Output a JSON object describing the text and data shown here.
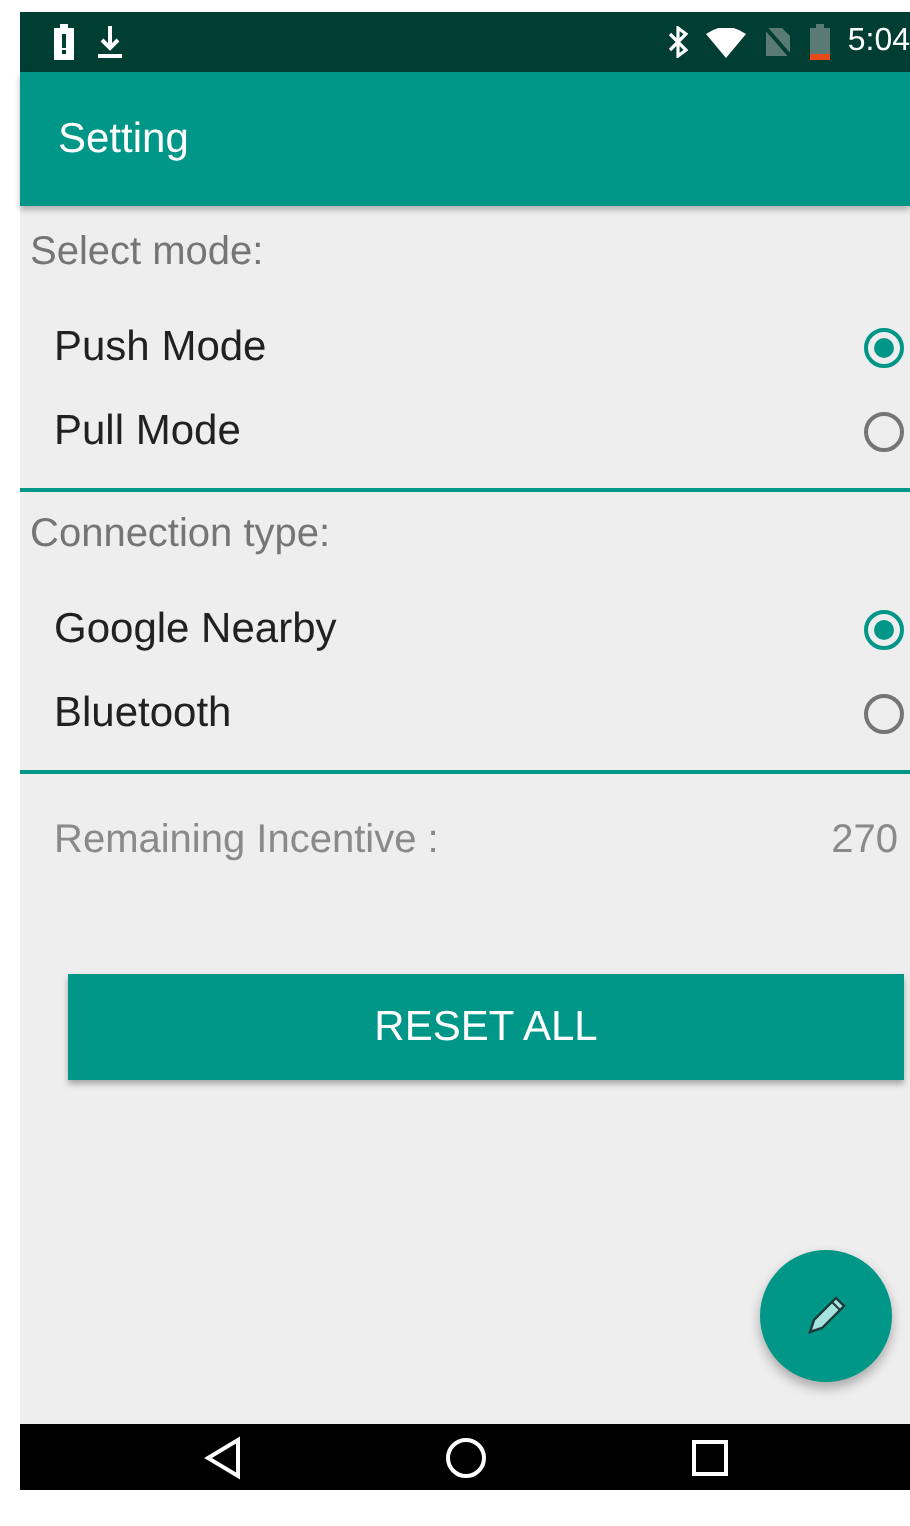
{
  "status_bar": {
    "time": "5:04"
  },
  "app_bar": {
    "title": "Setting"
  },
  "sections": [
    {
      "label": "Select mode:",
      "options": [
        {
          "label": "Push Mode",
          "selected": true
        },
        {
          "label": "Pull Mode",
          "selected": false
        }
      ]
    },
    {
      "label": "Connection type:",
      "options": [
        {
          "label": "Google Nearby",
          "selected": true
        },
        {
          "label": "Bluetooth",
          "selected": false
        }
      ]
    }
  ],
  "incentive": {
    "label": "Remaining Incentive :",
    "value": "270"
  },
  "reset_button": "RESET ALL"
}
